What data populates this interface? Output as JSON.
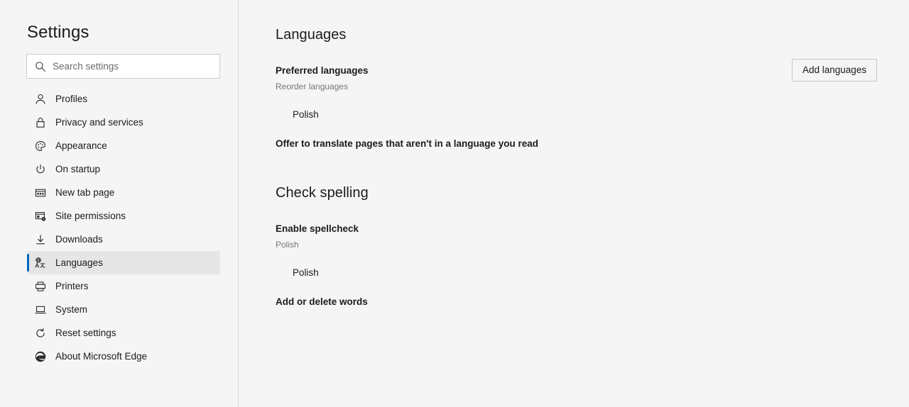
{
  "sidebar": {
    "title": "Settings",
    "search": {
      "placeholder": "Search settings",
      "value": "",
      "icon": "search-icon"
    },
    "items": [
      {
        "label": "Profiles",
        "icon": "person-icon",
        "selected": false
      },
      {
        "label": "Privacy and services",
        "icon": "lock-icon",
        "selected": false
      },
      {
        "label": "Appearance",
        "icon": "palette-icon",
        "selected": false
      },
      {
        "label": "On startup",
        "icon": "power-icon",
        "selected": false
      },
      {
        "label": "New tab page",
        "icon": "new-tab-icon",
        "selected": false
      },
      {
        "label": "Site permissions",
        "icon": "permissions-icon",
        "selected": false
      },
      {
        "label": "Downloads",
        "icon": "download-icon",
        "selected": false
      },
      {
        "label": "Languages",
        "icon": "translate-icon",
        "selected": true
      },
      {
        "label": "Printers",
        "icon": "printer-icon",
        "selected": false
      },
      {
        "label": "System",
        "icon": "laptop-icon",
        "selected": false
      },
      {
        "label": "Reset settings",
        "icon": "refresh-icon",
        "selected": false
      },
      {
        "label": "About Microsoft Edge",
        "icon": "edge-logo-icon",
        "selected": false
      }
    ]
  },
  "main": {
    "languages_heading": "Languages",
    "preferred_label": "Preferred languages",
    "preferred_sublabel": "Reorder languages",
    "add_languages_button": "Add languages",
    "language_row": {
      "name": "Polish",
      "more_icon": "more-horizontal-icon"
    },
    "translate_row": {
      "label": "Offer to translate pages that aren't in a language you read",
      "toggle_state": "on"
    },
    "spelling_heading": "Check spelling",
    "enable_spellcheck_label": "Enable spellcheck",
    "enable_spellcheck_sublabel": "Polish",
    "spell_language_row": {
      "name": "Polish",
      "toggle_state": "on"
    },
    "add_delete_words": {
      "label": "Add or delete words",
      "chevron_icon": "chevron-right-icon"
    }
  },
  "colors": {
    "accent": "#0067c0",
    "toggle_on": "#0f7bd4",
    "background": "#f5f5f5",
    "selected_row": "#e6e6e6",
    "text": "#1b1b1b",
    "muted_text": "#767676"
  }
}
